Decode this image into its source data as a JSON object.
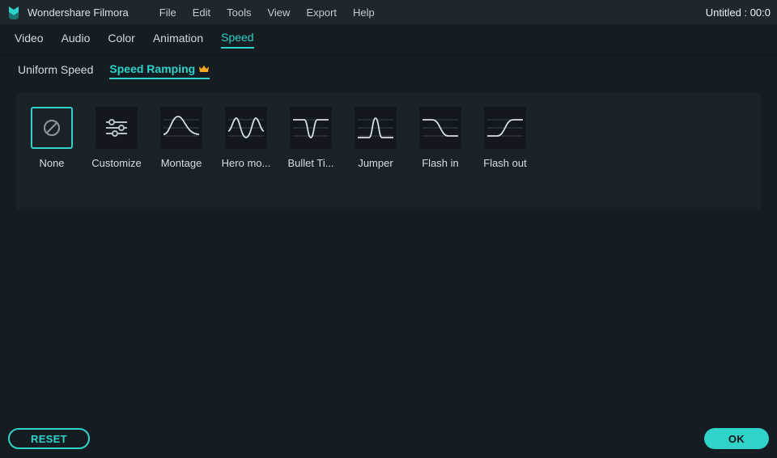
{
  "app_title": "Wondershare Filmora",
  "menubar": [
    "File",
    "Edit",
    "Tools",
    "View",
    "Export",
    "Help"
  ],
  "doc_title": "Untitled : 00:0",
  "tabs": [
    {
      "label": "Video",
      "active": false
    },
    {
      "label": "Audio",
      "active": false
    },
    {
      "label": "Color",
      "active": false
    },
    {
      "label": "Animation",
      "active": false
    },
    {
      "label": "Speed",
      "active": true
    }
  ],
  "subtabs": [
    {
      "label": "Uniform Speed",
      "active": false,
      "crown": false
    },
    {
      "label": "Speed Ramping",
      "active": true,
      "crown": true
    }
  ],
  "presets": [
    {
      "id": "none",
      "label": "None",
      "icon": "none",
      "selected": true
    },
    {
      "id": "customize",
      "label": "Customize",
      "icon": "sliders",
      "selected": false
    },
    {
      "id": "montage",
      "label": "Montage",
      "icon": "montage",
      "selected": false
    },
    {
      "id": "hero",
      "label": "Hero mo...",
      "icon": "hero",
      "selected": false
    },
    {
      "id": "bullet",
      "label": "Bullet Ti...",
      "icon": "bullet",
      "selected": false
    },
    {
      "id": "jumper",
      "label": "Jumper",
      "icon": "jumper",
      "selected": false
    },
    {
      "id": "flashin",
      "label": "Flash in",
      "icon": "flashin",
      "selected": false
    },
    {
      "id": "flashout",
      "label": "Flash out",
      "icon": "flashout",
      "selected": false
    }
  ],
  "buttons": {
    "reset": "RESET",
    "ok": "OK"
  },
  "colors": {
    "accent": "#2fd3c9",
    "bg": "#151c22",
    "panel": "#1a2229",
    "thumb": "#12181d"
  }
}
